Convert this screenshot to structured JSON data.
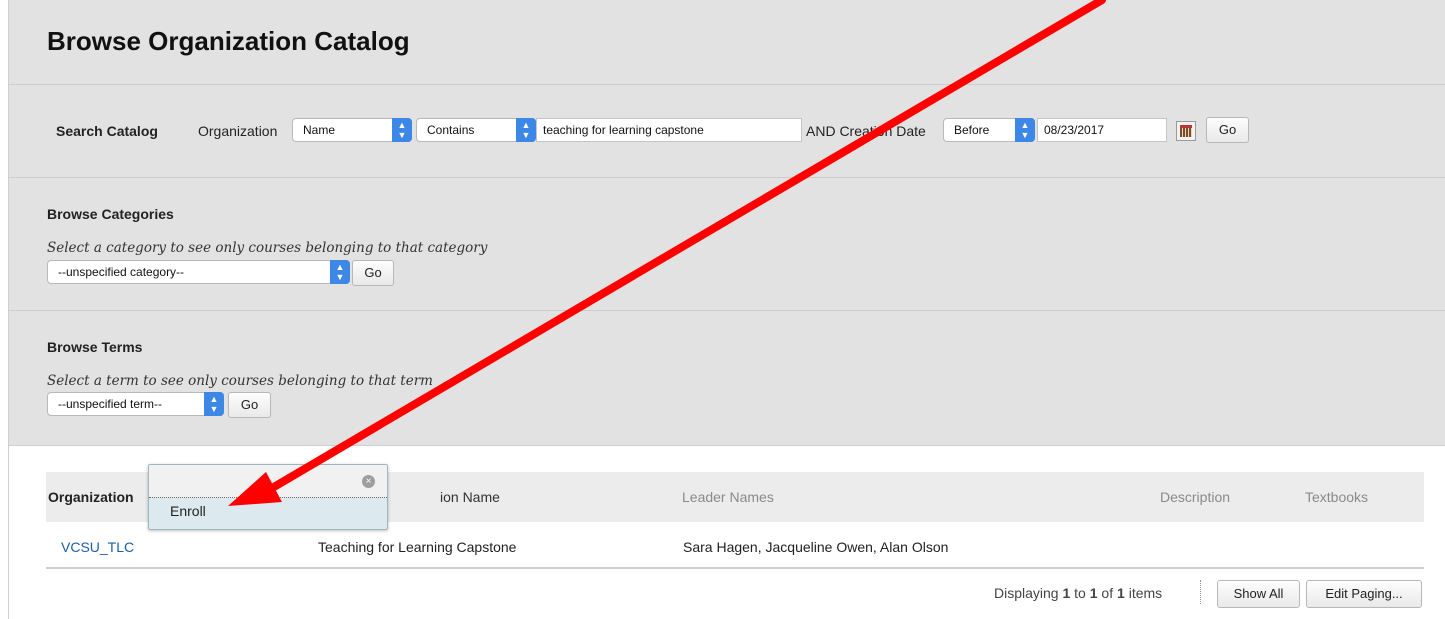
{
  "page": {
    "title": "Browse Organization Catalog"
  },
  "search": {
    "label": "Search Catalog",
    "field_label": "Organization",
    "field_select": "Name",
    "operator_select": "Contains",
    "query_value": "teaching for learning capstone",
    "date_label": "AND Creation Date",
    "date_operator": "Before",
    "date_value": "08/23/2017",
    "go_label": "Go"
  },
  "categories": {
    "title": "Browse Categories",
    "hint": "Select a category to see only courses belonging to that category",
    "selected": "--unspecified category--",
    "go_label": "Go"
  },
  "terms": {
    "title": "Browse Terms",
    "hint": "Select a term to see only courses belonging to that term",
    "selected": "--unspecified term--",
    "go_label": "Go"
  },
  "table": {
    "columns": [
      "Organization",
      "ion Name",
      "Leader Names",
      "Description",
      "Textbooks"
    ],
    "rows": [
      {
        "id": "VCSU_TLC",
        "name": "Teaching for Learning Capstone",
        "leaders": "Sara Hagen, Jacqueline Owen, Alan Olson"
      }
    ]
  },
  "popup": {
    "item": "Enroll",
    "close_glyph": "×"
  },
  "paging": {
    "prefix": "Displaying ",
    "from": "1",
    "mid1": " to ",
    "to": "1",
    "mid2": " of ",
    "total": "1",
    "suffix": " items",
    "show_all": "Show All",
    "edit_paging": "Edit Paging..."
  },
  "annotation": {
    "arrow_color": "#ff0000"
  },
  "icons": {
    "calendar": "calendar-icon",
    "close": "close-icon",
    "dropdown": "chevron-updown-icon"
  }
}
